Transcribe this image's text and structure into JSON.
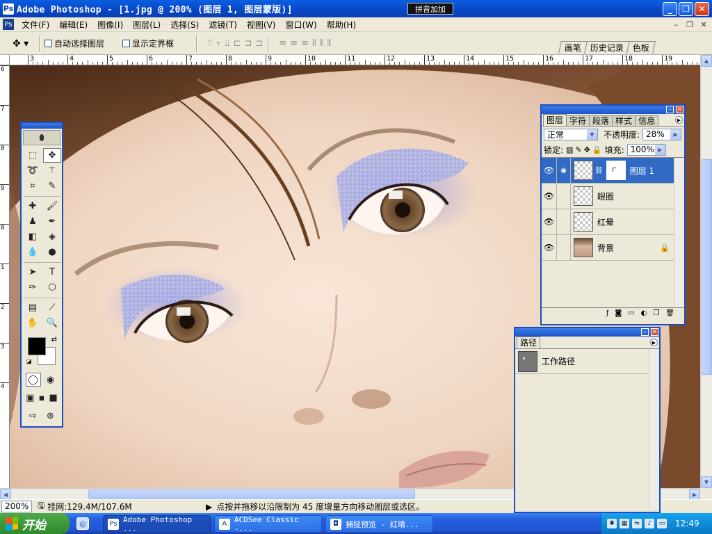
{
  "window": {
    "title": "Adobe Photoshop - [1.jpg @ 200% (图层 1, 图层蒙版)]",
    "ime_label": "拼音加加",
    "controls": [
      "_",
      "❐",
      "✕"
    ]
  },
  "menu": {
    "items": [
      "文件(F)",
      "编辑(E)",
      "图像(I)",
      "图层(L)",
      "选择(S)",
      "滤镜(T)",
      "视图(V)",
      "窗口(W)",
      "帮助(H)"
    ],
    "doc_controls": [
      "–",
      "❐",
      "✕"
    ]
  },
  "options": {
    "auto_select_layer": "自动选择图层",
    "show_bounding_box": "显示定界框",
    "palette_well_tabs": [
      "画笔",
      "历史记录",
      "色板"
    ]
  },
  "rulers": {
    "top_labels": [
      "3",
      "4",
      "5",
      "6",
      "7",
      "8",
      "9",
      "10",
      "11",
      "12",
      "13",
      "14",
      "15",
      "16",
      "17",
      "18",
      "19"
    ],
    "left_labels": [
      "6",
      "7",
      "8",
      "9",
      "0",
      "1",
      "2",
      "3",
      "4"
    ]
  },
  "status": {
    "zoom": "200%",
    "doc_size": "挂网:129.4M/107.6M",
    "message": "点按并拖移以沿限制为 45 度增量方向移动图层或选区。"
  },
  "taskbar": {
    "start_label": "开始",
    "tasks": [
      {
        "label": "Adobe Photoshop ...",
        "active": true
      },
      {
        "label": "ACDSee Classic -...",
        "active": false
      },
      {
        "label": "捕捉预览 - 红晴...",
        "active": false
      }
    ],
    "clock": "12:49"
  },
  "layers_panel": {
    "tabs": [
      "图层",
      "字符",
      "段落",
      "样式",
      "信息"
    ],
    "blend_mode": "正常",
    "opacity_label": "不透明度:",
    "opacity_value": "28%",
    "lock_label": "锁定:",
    "fill_label": "填充:",
    "fill_value": "100%",
    "layers": [
      {
        "name": "图层 1",
        "selected": true,
        "has_mask": true
      },
      {
        "name": "眼圈",
        "selected": false
      },
      {
        "name": "红晕",
        "selected": false
      },
      {
        "name": "背景",
        "selected": false,
        "locked": true
      }
    ]
  },
  "paths_panel": {
    "tab": "路径",
    "paths": [
      {
        "name": "工作路径"
      }
    ]
  },
  "colors": {
    "xp_blue": "#1d55c6",
    "selection": "#316ac5",
    "foreground": "#000000",
    "background": "#ffffff"
  }
}
